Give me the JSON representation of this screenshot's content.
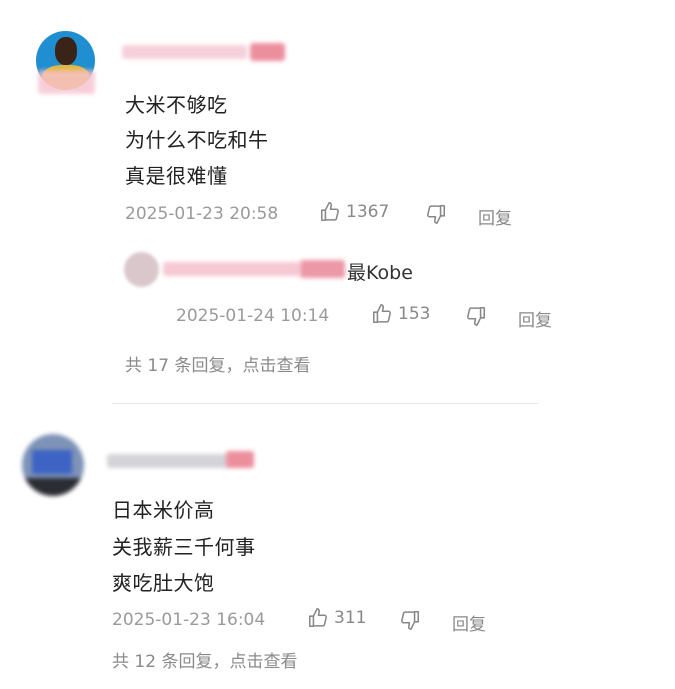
{
  "comments": [
    {
      "lines": [
        "大米不够吃",
        "为什么不吃和牛",
        "真是很难懂"
      ],
      "timestamp": "2025-01-23 20:58",
      "likes": "1367",
      "reply_label": "回复",
      "replies_summary": "共 17 条回复，点击查看",
      "reply": {
        "name_suffix": "最Kobe",
        "timestamp": "2025-01-24 10:14",
        "likes": "153",
        "reply_label": "回复"
      }
    },
    {
      "lines": [
        "日本米价高",
        "关我薪三千何事",
        "爽吃肚大饱"
      ],
      "timestamp": "2025-01-23 16:04",
      "likes": "311",
      "reply_label": "回复",
      "replies_summary": "共 12 条回复，点击查看"
    }
  ],
  "icons": {
    "like": "thumbs-up-icon",
    "dislike": "thumbs-down-icon"
  },
  "colors": {
    "meta_text": "#9a9a9a",
    "body_text": "#222222",
    "redacted_pink": "#f3b3c0"
  }
}
